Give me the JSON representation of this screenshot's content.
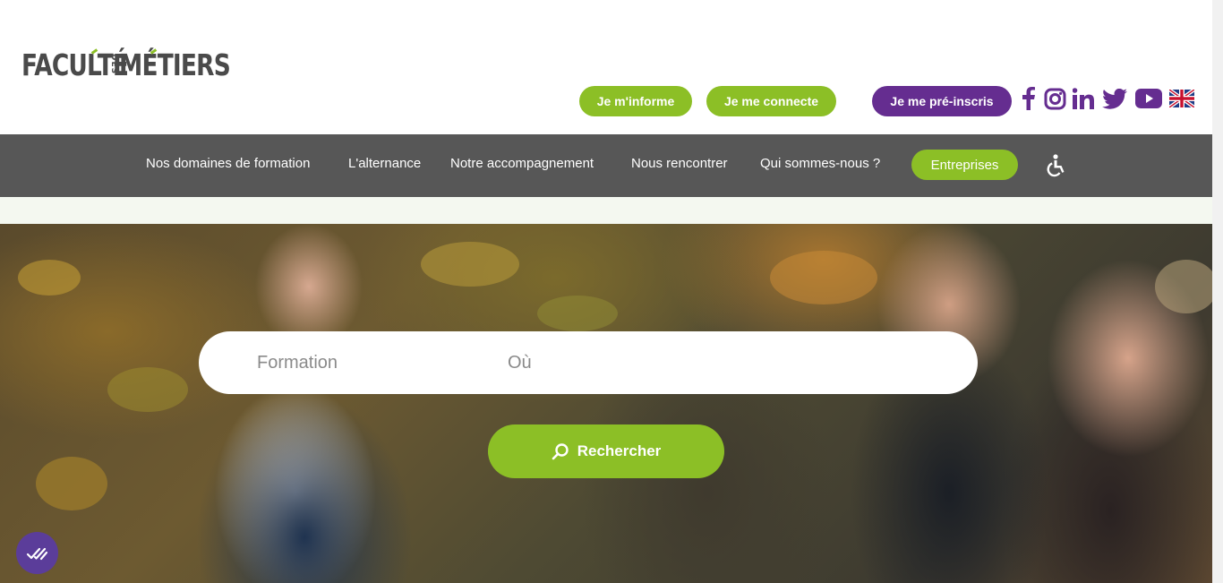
{
  "brand": {
    "word1": "FACULTÉ",
    "word2": "DES",
    "word3": "MÉTIERS",
    "accent_color": "#8cbf26",
    "text_color": "#4a4a4a"
  },
  "header": {
    "buttons": {
      "inform": "Je m'informe",
      "connect": "Je me connecte",
      "preregister": "Je me pré-inscris"
    },
    "social": [
      "facebook-icon",
      "instagram-icon",
      "linkedin-icon",
      "twitter-icon",
      "youtube-icon",
      "uk-flag-icon"
    ]
  },
  "nav": {
    "items": [
      "Nos domaines de formation",
      "L'alternance",
      "Notre accompagnement",
      "Nous rencontrer",
      "Qui sommes-nous ?"
    ],
    "cta": "Entreprises",
    "accessibility_icon": "accessibility-icon"
  },
  "search": {
    "formation_placeholder": "Formation",
    "where_placeholder": "Où",
    "button_label": "Rechercher",
    "button_icon": "search-icon"
  },
  "colors": {
    "green": "#8cbf26",
    "purple": "#652d90",
    "nav_bg": "#575757"
  },
  "cookie": {
    "icon": "check-double-icon"
  }
}
